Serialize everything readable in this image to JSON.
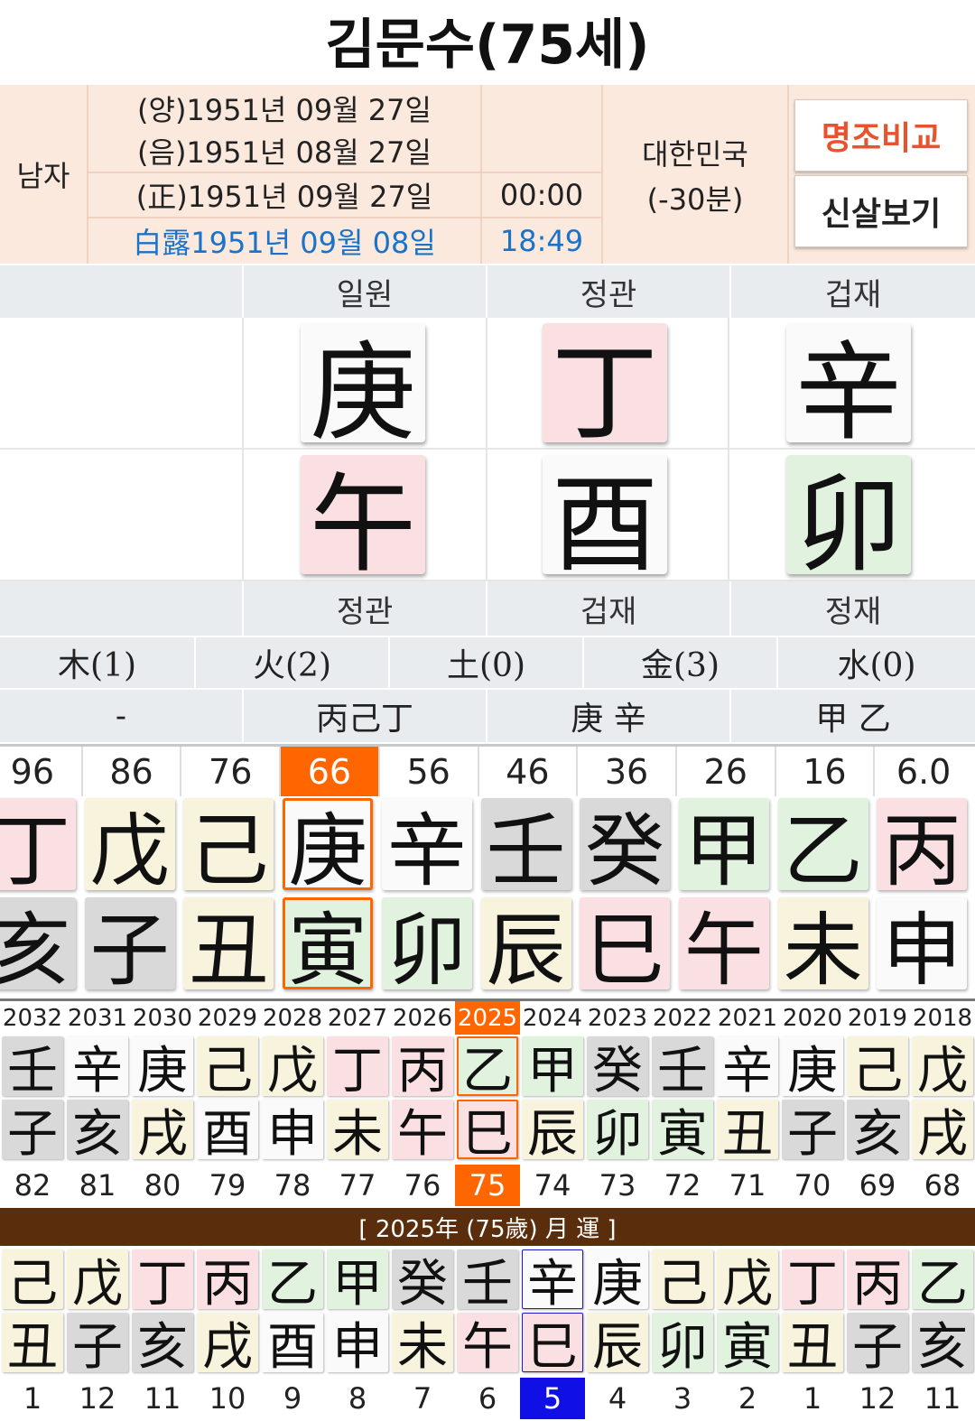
{
  "title": "김문수(75세)",
  "info": {
    "gender": "남자",
    "solar": "(양)1951년 09월 27일",
    "lunar": "(음)1951년 08월 27일",
    "corrected": "(正)1951년 09월 27일",
    "corrected_time": "00:00",
    "term": "白露1951년 09월 08일",
    "term_time": "18:49",
    "country": "대한민국",
    "offset": "(-30분)",
    "compare_button": "명조비교",
    "sinsal_button": "신살보기",
    "compare_color": "#e8522c"
  },
  "pillars": {
    "top_labels": [
      "",
      "일원",
      "정관",
      "겁재"
    ],
    "stems": [
      {
        "char": "",
        "color": "none"
      },
      {
        "char": "庚",
        "color": "white"
      },
      {
        "char": "丁",
        "color": "red"
      },
      {
        "char": "辛",
        "color": "white"
      }
    ],
    "branches": [
      {
        "char": "",
        "color": "none"
      },
      {
        "char": "午",
        "color": "red"
      },
      {
        "char": "酉",
        "color": "white"
      },
      {
        "char": "卯",
        "color": "green"
      }
    ],
    "bottom_labels": [
      "",
      "정관",
      "겁재",
      "정재"
    ]
  },
  "elements": [
    "木(1)",
    "火(2)",
    "土(0)",
    "金(3)",
    "水(0)"
  ],
  "hidden_stems": [
    "-",
    "丙己丁",
    "庚 辛",
    "甲 乙"
  ],
  "daeun": {
    "ages": [
      "96",
      "86",
      "76",
      "66",
      "56",
      "46",
      "36",
      "26",
      "16",
      "6.0"
    ],
    "selected_index": 3,
    "stems": [
      {
        "char": "丁",
        "color": "red"
      },
      {
        "char": "戊",
        "color": "yellow"
      },
      {
        "char": "己",
        "color": "yellow"
      },
      {
        "char": "庚",
        "color": "white"
      },
      {
        "char": "辛",
        "color": "white"
      },
      {
        "char": "壬",
        "color": "gray"
      },
      {
        "char": "癸",
        "color": "gray"
      },
      {
        "char": "甲",
        "color": "green"
      },
      {
        "char": "乙",
        "color": "green"
      },
      {
        "char": "丙",
        "color": "red"
      }
    ],
    "branches": [
      {
        "char": "亥",
        "color": "gray"
      },
      {
        "char": "子",
        "color": "gray"
      },
      {
        "char": "丑",
        "color": "yellow"
      },
      {
        "char": "寅",
        "color": "green"
      },
      {
        "char": "卯",
        "color": "green"
      },
      {
        "char": "辰",
        "color": "yellow"
      },
      {
        "char": "巳",
        "color": "red"
      },
      {
        "char": "午",
        "color": "red"
      },
      {
        "char": "未",
        "color": "yellow"
      },
      {
        "char": "申",
        "color": "white"
      }
    ]
  },
  "seun": {
    "years": [
      "2032",
      "2031",
      "2030",
      "2029",
      "2028",
      "2027",
      "2026",
      "2025",
      "2024",
      "2023",
      "2022",
      "2021",
      "2020",
      "2019",
      "2018"
    ],
    "selected_index": 7,
    "stems": [
      {
        "char": "壬",
        "color": "gray"
      },
      {
        "char": "辛",
        "color": "white"
      },
      {
        "char": "庚",
        "color": "white"
      },
      {
        "char": "己",
        "color": "yellow"
      },
      {
        "char": "戊",
        "color": "yellow"
      },
      {
        "char": "丁",
        "color": "red"
      },
      {
        "char": "丙",
        "color": "red"
      },
      {
        "char": "乙",
        "color": "green"
      },
      {
        "char": "甲",
        "color": "green"
      },
      {
        "char": "癸",
        "color": "gray"
      },
      {
        "char": "壬",
        "color": "gray"
      },
      {
        "char": "辛",
        "color": "white"
      },
      {
        "char": "庚",
        "color": "white"
      },
      {
        "char": "己",
        "color": "yellow"
      },
      {
        "char": "戊",
        "color": "yellow"
      }
    ],
    "branches": [
      {
        "char": "子",
        "color": "gray"
      },
      {
        "char": "亥",
        "color": "gray"
      },
      {
        "char": "戌",
        "color": "yellow"
      },
      {
        "char": "酉",
        "color": "white"
      },
      {
        "char": "申",
        "color": "white"
      },
      {
        "char": "未",
        "color": "yellow"
      },
      {
        "char": "午",
        "color": "red"
      },
      {
        "char": "巳",
        "color": "red"
      },
      {
        "char": "辰",
        "color": "yellow"
      },
      {
        "char": "卯",
        "color": "green"
      },
      {
        "char": "寅",
        "color": "green"
      },
      {
        "char": "丑",
        "color": "yellow"
      },
      {
        "char": "子",
        "color": "gray"
      },
      {
        "char": "亥",
        "color": "gray"
      },
      {
        "char": "戌",
        "color": "yellow"
      }
    ],
    "ages": [
      "82",
      "81",
      "80",
      "79",
      "78",
      "77",
      "76",
      "75",
      "74",
      "73",
      "72",
      "71",
      "70",
      "69",
      "68"
    ]
  },
  "wolun": {
    "header": "[ 2025年 (75歲) 月 運 ]",
    "selected_index": 8,
    "stems": [
      {
        "char": "己",
        "color": "yellow"
      },
      {
        "char": "戊",
        "color": "yellow"
      },
      {
        "char": "丁",
        "color": "red"
      },
      {
        "char": "丙",
        "color": "red"
      },
      {
        "char": "乙",
        "color": "green"
      },
      {
        "char": "甲",
        "color": "green"
      },
      {
        "char": "癸",
        "color": "gray"
      },
      {
        "char": "壬",
        "color": "gray"
      },
      {
        "char": "辛",
        "color": "white"
      },
      {
        "char": "庚",
        "color": "white"
      },
      {
        "char": "己",
        "color": "yellow"
      },
      {
        "char": "戊",
        "color": "yellow"
      },
      {
        "char": "丁",
        "color": "red"
      },
      {
        "char": "丙",
        "color": "red"
      },
      {
        "char": "乙",
        "color": "green"
      }
    ],
    "branches": [
      {
        "char": "丑",
        "color": "yellow"
      },
      {
        "char": "子",
        "color": "gray"
      },
      {
        "char": "亥",
        "color": "gray"
      },
      {
        "char": "戌",
        "color": "yellow"
      },
      {
        "char": "酉",
        "color": "white"
      },
      {
        "char": "申",
        "color": "white"
      },
      {
        "char": "未",
        "color": "yellow"
      },
      {
        "char": "午",
        "color": "red"
      },
      {
        "char": "巳",
        "color": "red"
      },
      {
        "char": "辰",
        "color": "yellow"
      },
      {
        "char": "卯",
        "color": "green"
      },
      {
        "char": "寅",
        "color": "green"
      },
      {
        "char": "丑",
        "color": "yellow"
      },
      {
        "char": "子",
        "color": "gray"
      },
      {
        "char": "亥",
        "color": "gray"
      }
    ],
    "months": [
      "1",
      "12",
      "11",
      "10",
      "9",
      "8",
      "7",
      "6",
      "5",
      "4",
      "3",
      "2",
      "1",
      "12",
      "11"
    ]
  }
}
